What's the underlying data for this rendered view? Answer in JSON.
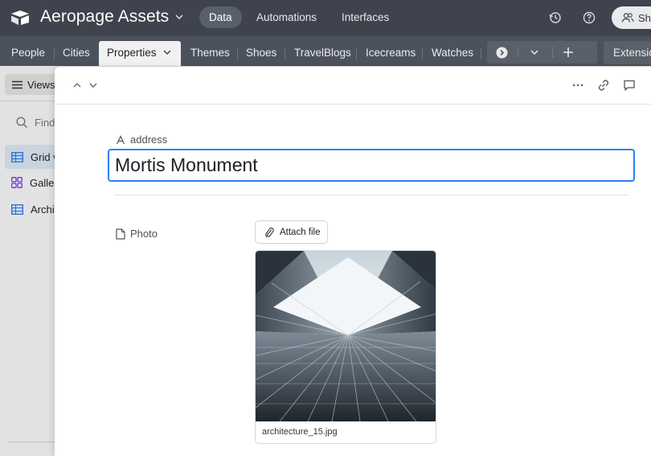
{
  "app": {
    "title": "Aeropage Assets"
  },
  "nav": {
    "items": [
      "Data",
      "Automations",
      "Interfaces"
    ],
    "active": "Data"
  },
  "header": {
    "share_label": "Sha"
  },
  "tabs": {
    "items": [
      "People",
      "Cities",
      "Properties",
      "Themes",
      "Shoes",
      "TravelBlogs",
      "Icecreams",
      "Watches"
    ],
    "active": "Properties",
    "extensions_label": "Extensio"
  },
  "sidebar": {
    "views_label": "Views",
    "find_placeholder": "Find",
    "items": [
      {
        "label": "Grid v",
        "icon": "grid-icon",
        "color": "#2d7ff9"
      },
      {
        "label": "Galle",
        "icon": "gallery-icon",
        "color": "#7c39ed"
      },
      {
        "label": "Archi",
        "icon": "grid-icon",
        "color": "#2d7ff9"
      }
    ]
  },
  "record": {
    "primary_field_label": "address",
    "primary_value": "Mortis Monument",
    "photo_field_label": "Photo",
    "attach_label": "Attach file",
    "attachment_filename": "architecture_15.jpg"
  },
  "colors": {
    "topbar": "#3e434d",
    "tabbar": "#4c525d",
    "focus_border": "#2d7ff9"
  }
}
